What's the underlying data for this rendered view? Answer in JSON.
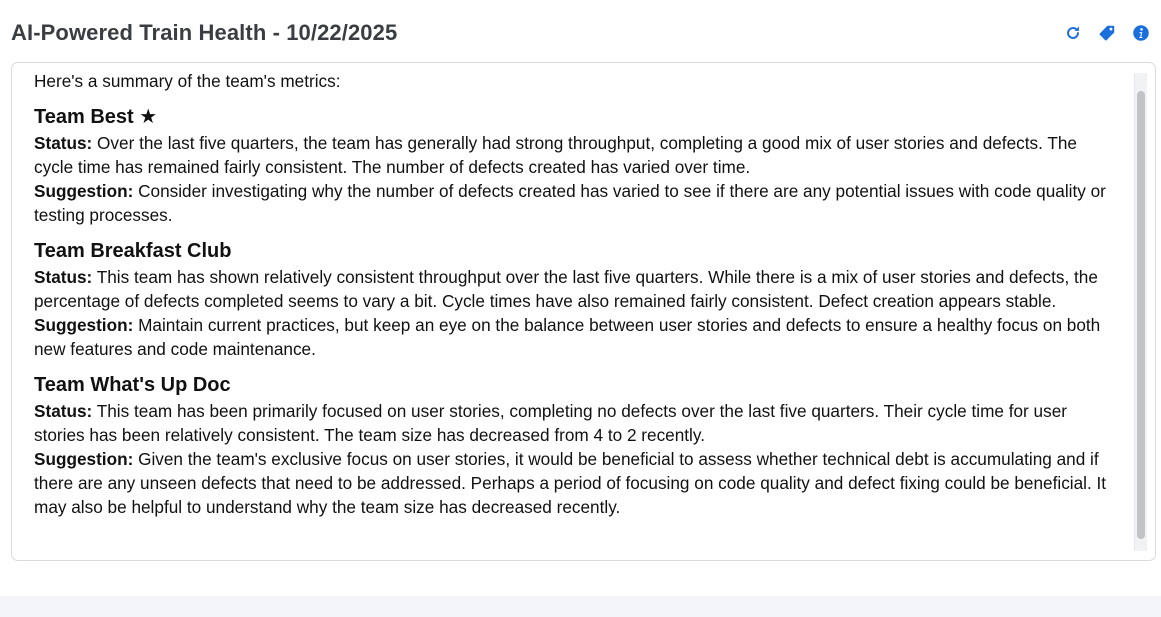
{
  "header": {
    "title": "AI-Powered Train Health - 10/22/2025",
    "icons": [
      "refresh-icon",
      "tag-icon",
      "info-icon"
    ],
    "icon_color": "#1a6fdc"
  },
  "summary": {
    "intro": "Here's a summary of the team's metrics:",
    "status_label": "Status:",
    "suggestion_label": "Suggestion:",
    "teams": [
      {
        "name": "Team Best ★",
        "status": "Over the last five quarters, the team has generally had strong throughput, completing a good mix of user stories and defects. The cycle time has remained fairly consistent. The number of defects created has varied over time.",
        "suggestion": "Consider investigating why the number of defects created has varied to see if there are any potential issues with code quality or testing processes."
      },
      {
        "name": "Team Breakfast Club",
        "status": "This team has shown relatively consistent throughput over the last five quarters. While there is a mix of user stories and defects, the percentage of defects completed seems to vary a bit. Cycle times have also remained fairly consistent. Defect creation appears stable.",
        "suggestion": "Maintain current practices, but keep an eye on the balance between user stories and defects to ensure a healthy focus on both new features and code maintenance."
      },
      {
        "name": "Team What's Up Doc",
        "status": "This team has been primarily focused on user stories, completing no defects over the last five quarters. Their cycle time for user stories has been relatively consistent. The team size has decreased from 4 to 2 recently.",
        "suggestion": "Given the team's exclusive focus on user stories, it would be beneficial to assess whether technical debt is accumulating and if there are any unseen defects that need to be addressed. Perhaps a period of focusing on code quality and defect fixing could be beneficial. It may also be helpful to understand why the team size has decreased recently."
      }
    ]
  }
}
